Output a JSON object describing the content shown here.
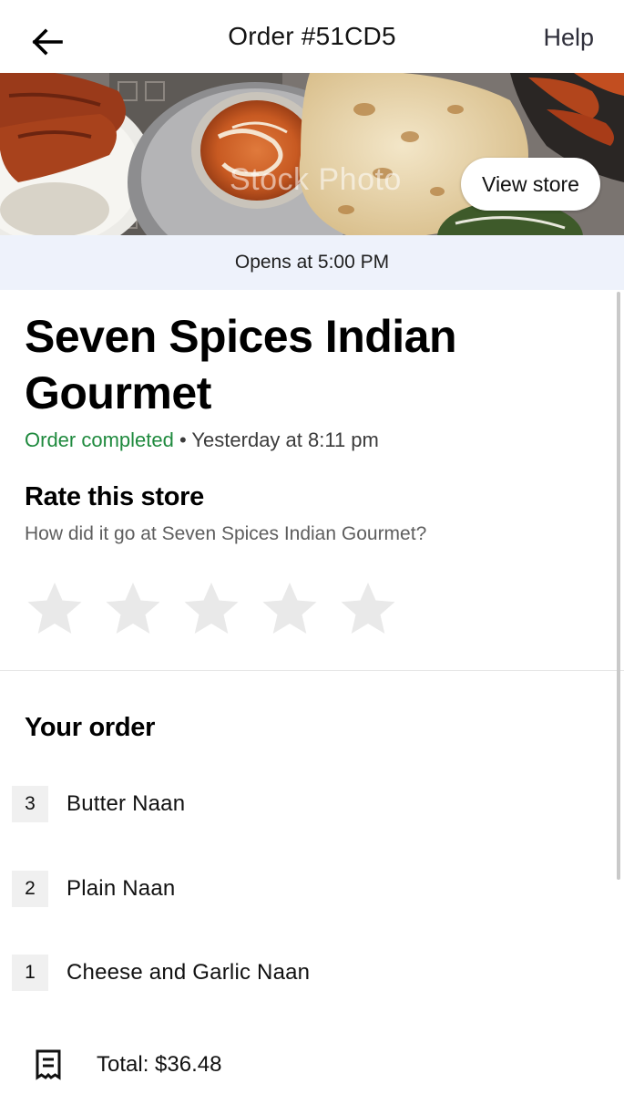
{
  "header": {
    "title": "Order #51CD5",
    "help_label": "Help",
    "back_icon": "arrow-left-icon"
  },
  "hero": {
    "watermark": "Stock Photo",
    "view_store_label": "View store"
  },
  "banner": {
    "text": "Opens at 5:00 PM"
  },
  "store": {
    "name": "Seven Spices Indian Gourmet",
    "status": "Order completed",
    "separator": " • ",
    "timestamp": "Yesterday at 8:11 pm"
  },
  "rating": {
    "title": "Rate this store",
    "subtitle": "How did it go at Seven Spices Indian Gourmet?",
    "max_stars": 5,
    "selected_stars": 0
  },
  "order": {
    "title": "Your order",
    "items": [
      {
        "qty": "3",
        "name": "Butter Naan"
      },
      {
        "qty": "2",
        "name": "Plain Naan"
      },
      {
        "qty": "1",
        "name": "Cheese and Garlic Naan"
      }
    ],
    "total": "Total: $36.48",
    "total_icon": "receipt-icon"
  },
  "colors": {
    "status_green": "#1f8a3e",
    "banner_bg": "#eef2fb",
    "star_empty": "#e9e9e9"
  }
}
